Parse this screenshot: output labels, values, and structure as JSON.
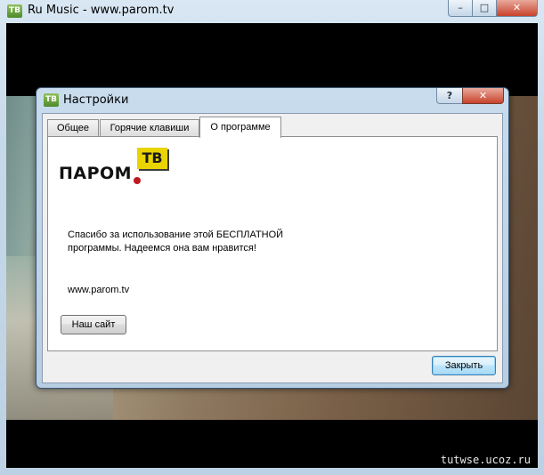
{
  "outer_window": {
    "icon_text": "TB",
    "title": "Ru Music - www.parom.tv",
    "minimize": "–",
    "maximize": "□",
    "close": "✕"
  },
  "dialog": {
    "icon_text": "TB",
    "title": "Настройки",
    "help": "?",
    "close": "✕",
    "tabs": [
      {
        "label": "Общее",
        "selected": false
      },
      {
        "label": "Горячие клавиши",
        "selected": false
      },
      {
        "label": "О программе",
        "selected": true
      }
    ],
    "logo": {
      "word": "ПАРОМ",
      "badge": "ТВ"
    },
    "message": "Спасибо за использование этой БЕСПЛАТНОЙ программы. Надеемся она вам нравится!",
    "site": "www.parom.tv",
    "site_button": "Наш сайт",
    "close_button": "Закрыть"
  },
  "watermark": "tutwse.ucoz.ru",
  "colors": {
    "logo_badge": "#e9d300",
    "logo_dot": "#c0181f",
    "close_red": "#c8432b"
  }
}
